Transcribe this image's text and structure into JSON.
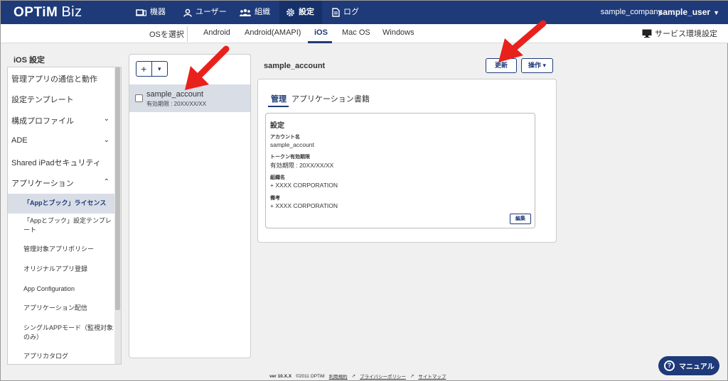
{
  "header": {
    "logo": "OPTiM",
    "logo_sub": "Biz",
    "nav": [
      {
        "label": "機器",
        "icon": "device-icon"
      },
      {
        "label": "ユーザー",
        "icon": "user-icon"
      },
      {
        "label": "組織",
        "icon": "organization-icon"
      },
      {
        "label": "設定",
        "icon": "gear-icon"
      },
      {
        "label": "ログ",
        "icon": "log-icon"
      }
    ],
    "active_nav": "設定",
    "company": "sample_company",
    "user": "sample_user"
  },
  "osbar": {
    "label": "OSを選択",
    "tabs": [
      "Android",
      "Android(AMAPI)",
      "iOS",
      "Mac OS",
      "Windows"
    ],
    "active": "iOS",
    "service": "サービス環境設定"
  },
  "sidebar": {
    "title": "iOS 設定",
    "items": [
      {
        "label": "管理アプリの通信と動作"
      },
      {
        "label": "設定テンプレート"
      },
      {
        "label": "構成プロファイル",
        "chevron": "down"
      },
      {
        "label": "ADE",
        "chevron": "down"
      },
      {
        "label": "Shared iPadセキュリティ"
      },
      {
        "label": "アプリケーション",
        "chevron": "up"
      }
    ],
    "subitems": [
      "「Appとブック」ライセンス",
      "「Appとブック」設定テンプレート",
      "管理対象アプリポリシー",
      "オリジナルアプリ登録",
      "App Configuration",
      "アプリケーション配信",
      "シングルAPPモード（監視対象のみ）",
      "アプリカタログ"
    ],
    "active_sub": "「Appとブック」ライセンス"
  },
  "accounts": {
    "add_symbol": "+",
    "items": [
      {
        "name": "sample_account",
        "expiry": "有効期限 : 20XX/XX/XX",
        "checked": false
      }
    ]
  },
  "detail": {
    "title": "sample_account",
    "update_button": "更新",
    "actions_button": "操作",
    "tabs": [
      "管理",
      "アプリケーション",
      "書籍"
    ],
    "active_tab": "管理",
    "section_title": "設定",
    "fields": [
      {
        "label": "アカウント名",
        "value": "sample_account"
      },
      {
        "label": "トークン有効期限",
        "value": "有効期限 : 20XX/XX/XX"
      },
      {
        "label": "組織名",
        "value": "+ XXXX CORPORATION"
      },
      {
        "label": "備考",
        "value": "+ XXXX CORPORATION"
      }
    ],
    "edit_button": "編集"
  },
  "footer": {
    "version": "ver 10.X.X",
    "copyright": "©2011 OPTiM",
    "terms": "利用規約",
    "privacy": "プライバシーポリシー",
    "sitemap": "サイトマップ"
  },
  "manual_button": "マニュアル",
  "colors": {
    "brand": "#1e3a78",
    "highlight": "#d8dde6",
    "annotation_arrow": "#e8211d"
  }
}
